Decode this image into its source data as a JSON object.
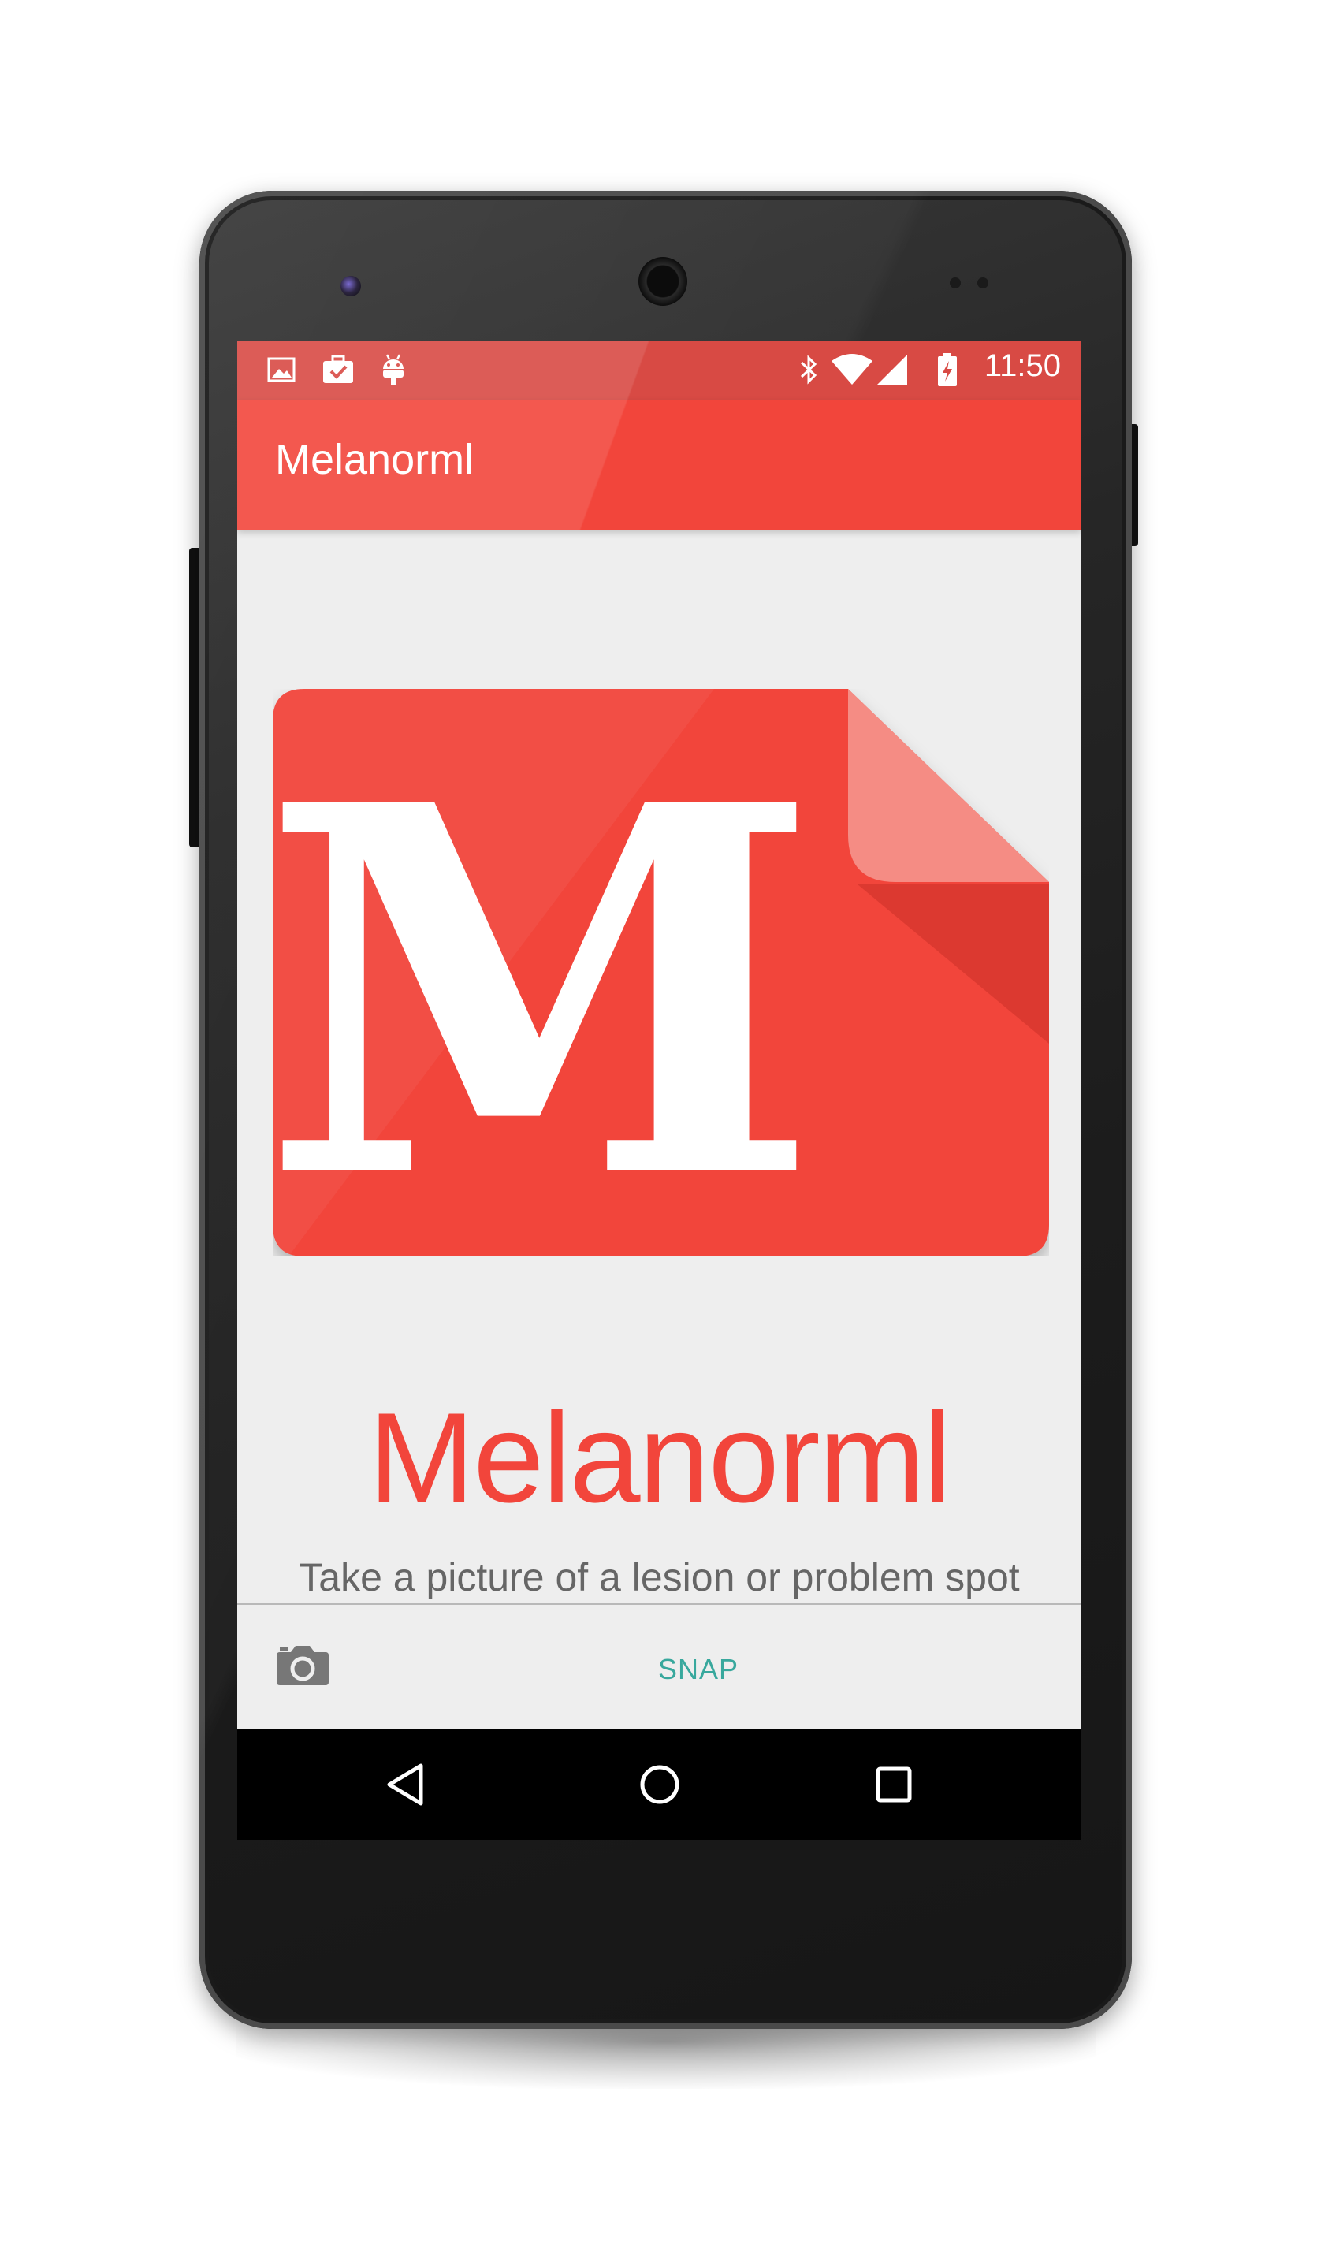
{
  "status_bar": {
    "time": "11:50",
    "left_icons": [
      "image-icon",
      "briefcase-check-icon",
      "android-icon"
    ],
    "right_icons": [
      "bluetooth-icon",
      "wifi-icon",
      "cell-signal-icon",
      "battery-charging-icon"
    ]
  },
  "app_bar": {
    "title": "Melanorml"
  },
  "main": {
    "logo_letter": "M",
    "brand_name": "Melanorml",
    "subtitle": "Take a picture of a lesion or problem spot"
  },
  "action_bar": {
    "camera_icon": "camera-icon",
    "snap_label": "SNAP"
  },
  "nav_bar": {
    "icons": [
      "back-icon",
      "home-icon",
      "recents-icon"
    ]
  },
  "colors": {
    "accent": "#f2453b",
    "status_bar": "#d84a44",
    "snap_text": "#38a89d",
    "background": "#eeeeee"
  }
}
